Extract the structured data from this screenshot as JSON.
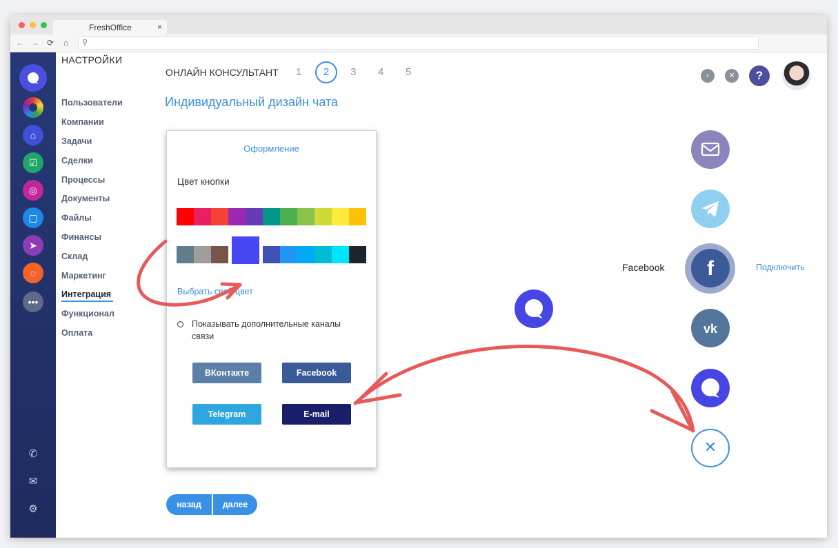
{
  "browser": {
    "tab_title": "FreshOffice",
    "tab_close": "×"
  },
  "settings": {
    "title": "НАСТРОЙКИ",
    "menu": [
      "Пользователи",
      "Компании",
      "Задачи",
      "Сделки",
      "Процессы",
      "Документы",
      "Файлы",
      "Финансы",
      "Склад",
      "Маркетинг",
      "Интеграция",
      "Функционал",
      "Оплата"
    ],
    "active_item": "Интеграция"
  },
  "wizard": {
    "title": "ОНЛАЙН КОНСУЛЬТАНТ",
    "steps": [
      "1",
      "2",
      "3",
      "4",
      "5"
    ],
    "active_step": "2",
    "page_title": "Индивидуальный дизайн чата"
  },
  "panel": {
    "title": "Оформление",
    "color_label": "Цвет кнопки",
    "palette_row1": [
      "#ff0000",
      "#e91e63",
      "#f44336",
      "#9c27b0",
      "#673ab7",
      "#009688",
      "#4caf50",
      "#8bc34a",
      "#cddc39",
      "#ffeb3b",
      "#ffc107"
    ],
    "palette_row2": [
      "#607d8b",
      "#9e9e9e",
      "#795548",
      "#4646f2",
      "#3f51b5",
      "#2196f3",
      "#03a9f4",
      "#00bcd4",
      "#00e5ff",
      "#1c2430"
    ],
    "selected_color": "#4646f2",
    "pick_link": "Выбрать свой цвет",
    "show_channels_label": "Показывать дополнительные каналы связи",
    "channel_buttons": {
      "vk": {
        "label": "ВКонтакте",
        "color": "#5b7fa6"
      },
      "facebook": {
        "label": "Facebook",
        "color": "#3b5a9a"
      },
      "telegram": {
        "label": "Telegram",
        "color": "#2ea6e0"
      },
      "email": {
        "label": "E-mail",
        "color": "#1a1f6b"
      }
    }
  },
  "nav": {
    "back": "назад",
    "next": "далее"
  },
  "preview": {
    "channels": [
      {
        "name": "email",
        "color": "#8a86bd"
      },
      {
        "name": "telegram",
        "color": "#8fd0f0"
      },
      {
        "name": "facebook",
        "color": "#3b5a9a"
      },
      {
        "name": "vk",
        "color": "#54769a"
      },
      {
        "name": "chat",
        "color": "#4746e4"
      }
    ],
    "facebook_label": "Facebook",
    "connect_link": "Подключить"
  },
  "accent": "#3b8fe0"
}
